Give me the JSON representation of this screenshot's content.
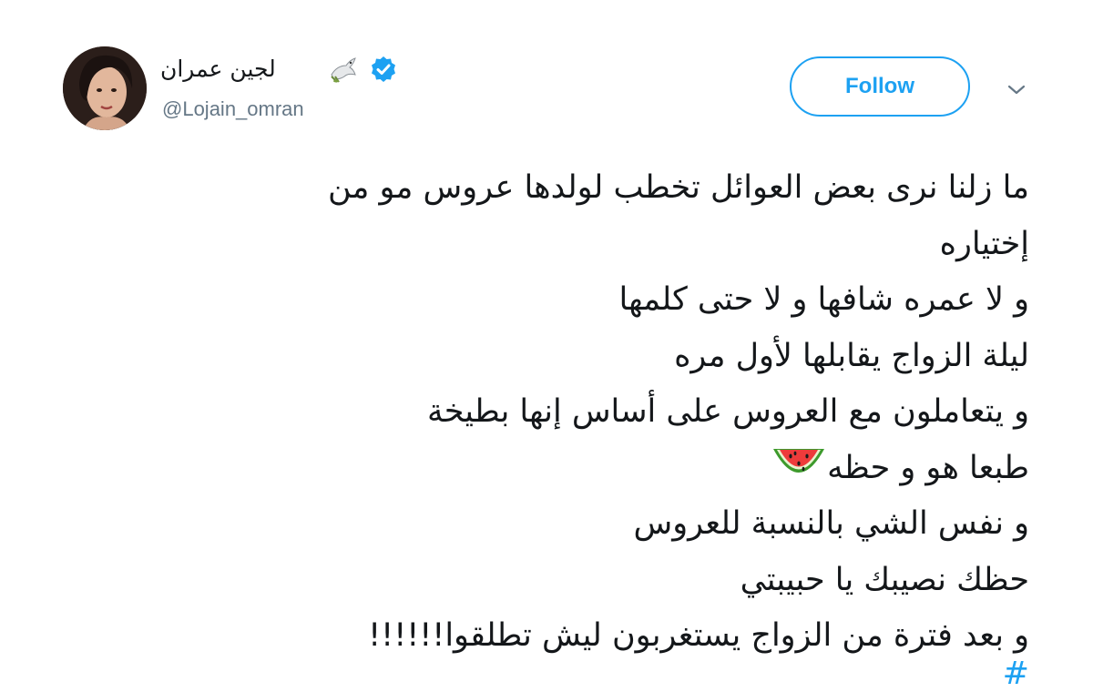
{
  "author": {
    "display_name": "لجين عمران",
    "handle": "@Lojain_omran",
    "verified": true
  },
  "actions": {
    "follow_label": "Follow"
  },
  "icons": {
    "avatar": "profile-photo",
    "name_emoji": "dove-icon",
    "verified": "verified-badge-icon",
    "menu": "chevron-down-icon",
    "inline_emoji": "watermelon-icon"
  },
  "tweet": {
    "lines": [
      "ما زلنا نرى بعض العوائل تخطب لولدها عروس مو من",
      "إختياره",
      "و لا عمره شافها و لا حتى كلمها",
      "ليلة الزواج يقابلها لأول مره",
      "و يتعاملون مع العروس على أساس إنها بطيخة",
      "طبعا هو و حظه",
      "و نفس الشي بالنسبة للعروس",
      "حظك نصيبك يا حبيبتي",
      "و بعد فترة من الزواج يستغربون ليش تطلقوا!!!!!!"
    ],
    "hashtag_partial": "#"
  },
  "colors": {
    "brand_blue": "#1da1f2",
    "text": "#14171a",
    "secondary_text": "#657786"
  }
}
